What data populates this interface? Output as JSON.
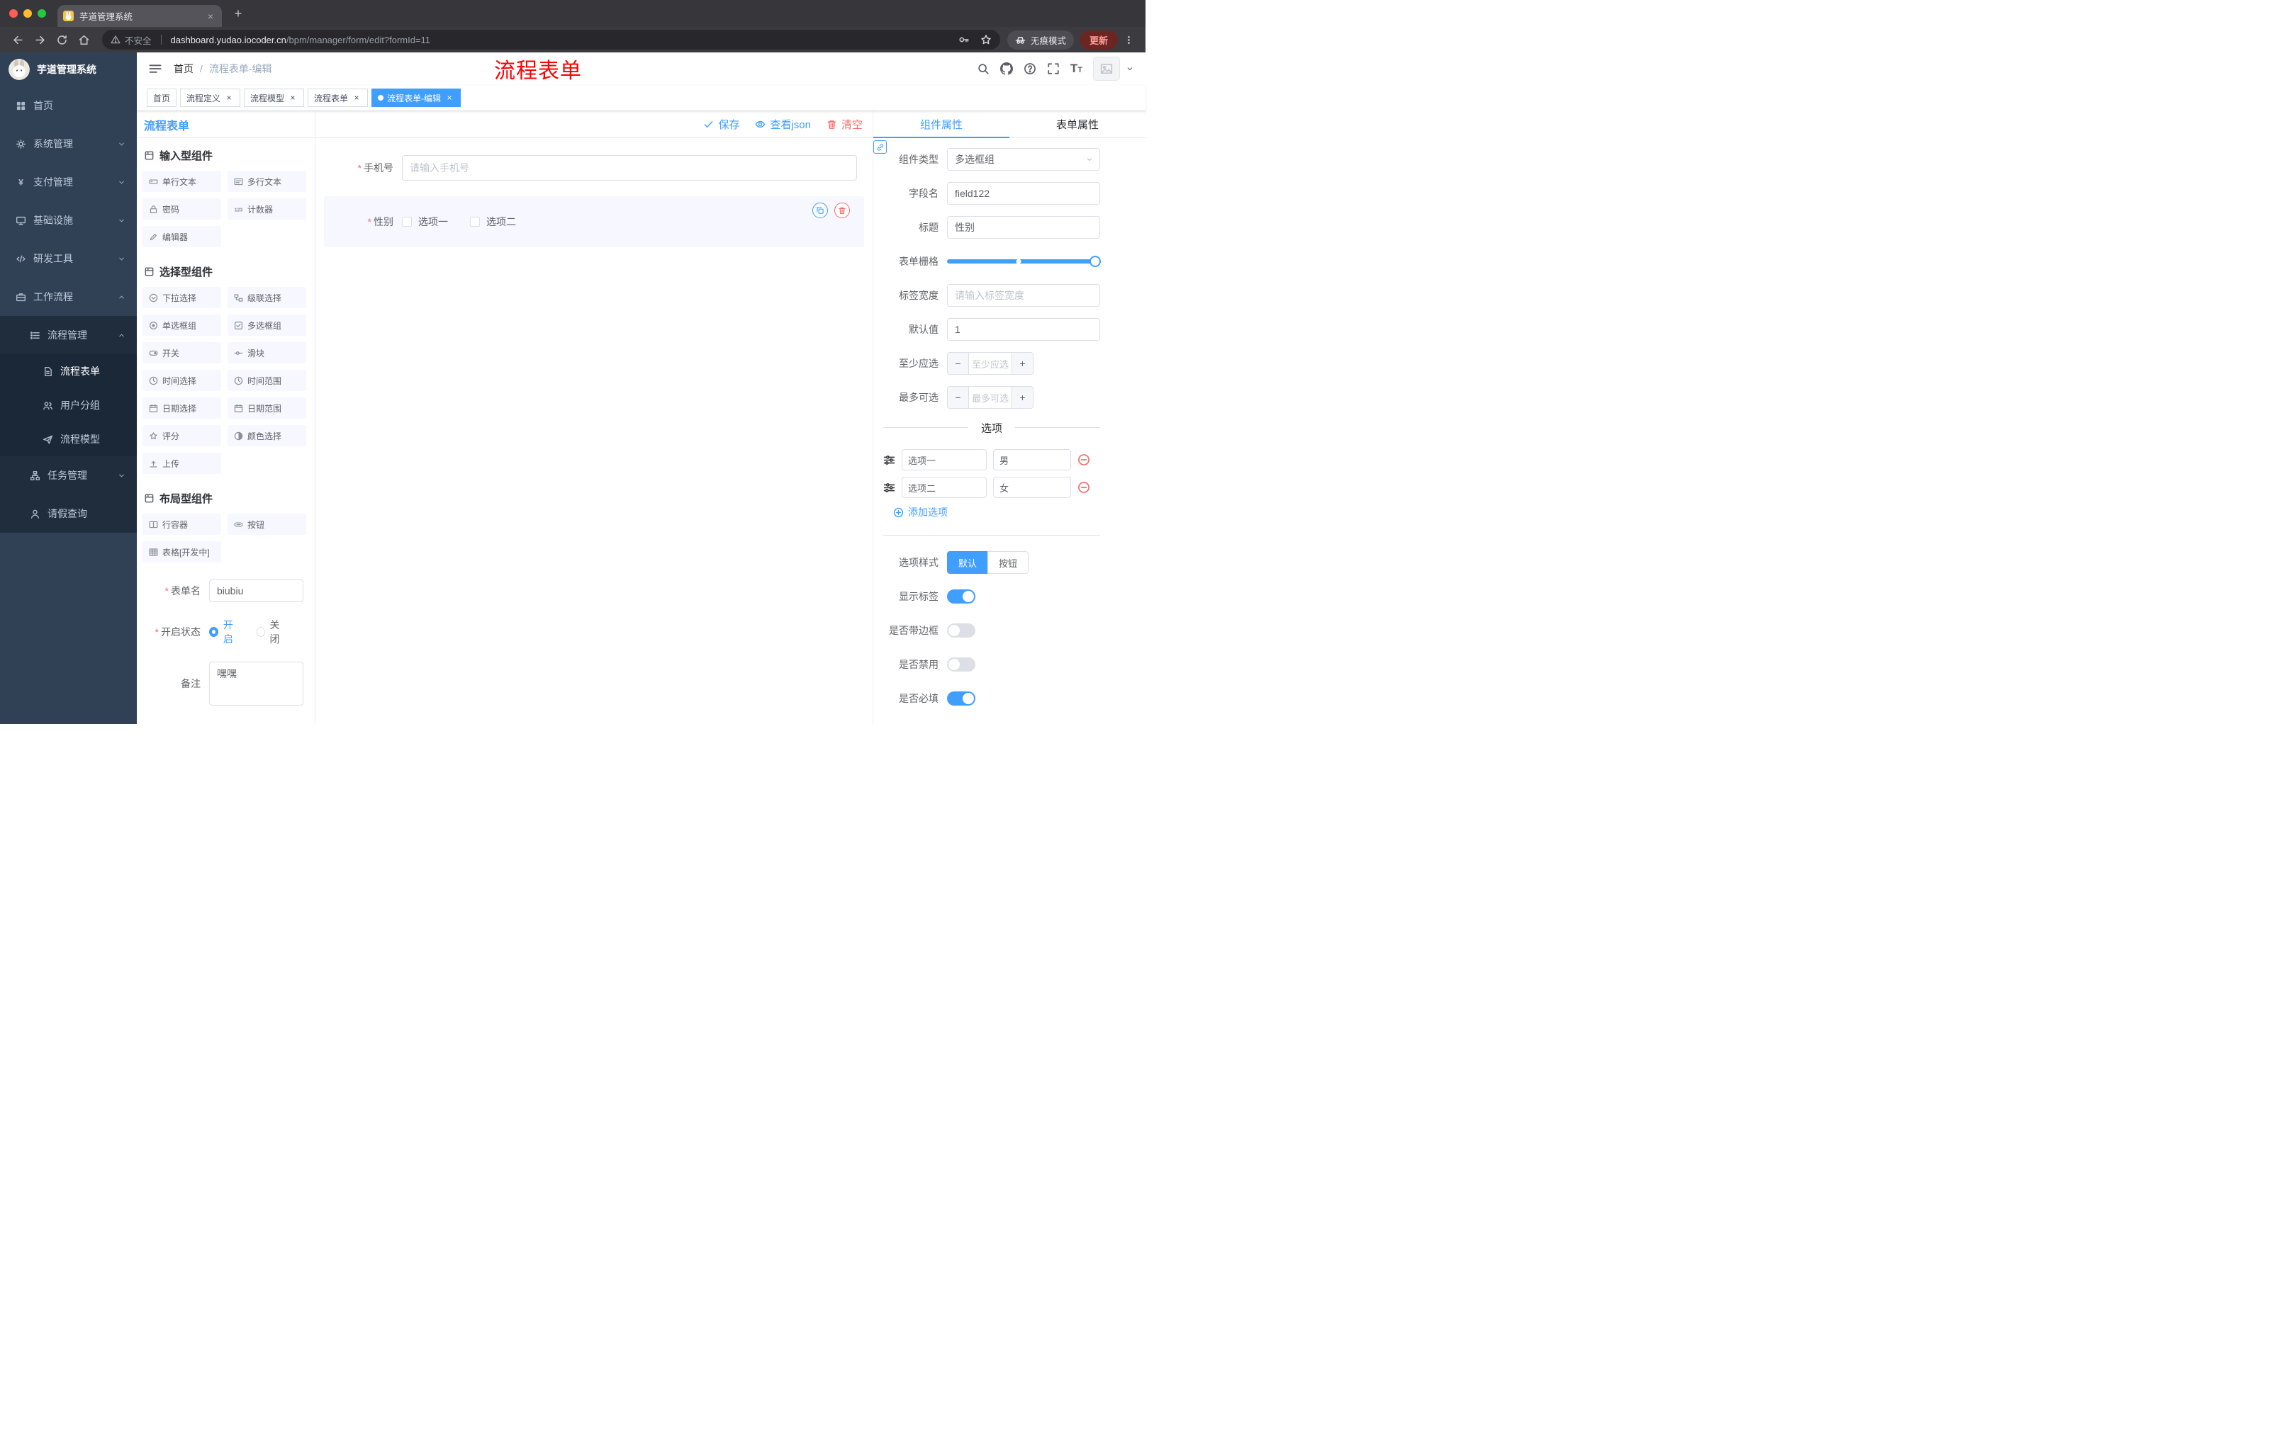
{
  "browser": {
    "tab_title": "芋道管理系统",
    "security_label": "不安全",
    "url_host": "dashboard.yudao.iocoder.cn",
    "url_path": "/bpm/manager/form/edit?formId=11",
    "incognito_label": "无痕模式",
    "update_label": "更新"
  },
  "sidebar": {
    "logo_title": "芋道管理系统",
    "menu": [
      {
        "label": "首页",
        "icon": "dashboard",
        "level": 1
      },
      {
        "label": "系统管理",
        "icon": "gear",
        "level": 1,
        "chevron": "down"
      },
      {
        "label": "支付管理",
        "icon": "yen",
        "level": 1,
        "chevron": "down"
      },
      {
        "label": "基础设施",
        "icon": "monitor",
        "level": 1,
        "chevron": "down"
      },
      {
        "label": "研发工具",
        "icon": "tools",
        "level": 1,
        "chevron": "down"
      },
      {
        "label": "工作流程",
        "icon": "briefcase",
        "level": 1,
        "chevron": "up"
      },
      {
        "label": "流程管理",
        "icon": "list",
        "level": 2,
        "chevron": "up"
      },
      {
        "label": "流程表单",
        "icon": "document",
        "level": 3,
        "active": true
      },
      {
        "label": "用户分组",
        "icon": "users",
        "level": 3
      },
      {
        "label": "流程模型",
        "icon": "send",
        "level": 3
      },
      {
        "label": "任务管理",
        "icon": "tree",
        "level": 2,
        "chevron": "down"
      },
      {
        "label": "请假查询",
        "icon": "user",
        "level": 2
      }
    ]
  },
  "navbar": {
    "breadcrumb": [
      "首页",
      "流程表单-编辑"
    ],
    "annotation": "流程表单"
  },
  "tags": [
    {
      "label": "首页",
      "closable": false,
      "active": false
    },
    {
      "label": "流程定义",
      "closable": true,
      "active": false
    },
    {
      "label": "流程模型",
      "closable": true,
      "active": false
    },
    {
      "label": "流程表单",
      "closable": true,
      "active": false
    },
    {
      "label": "流程表单-编辑",
      "closable": true,
      "active": true
    }
  ],
  "editor": {
    "title": "流程表单",
    "actions": {
      "save": "保存",
      "view_json": "查看json",
      "clear": "清空"
    },
    "component_groups": [
      {
        "title": "输入型组件",
        "items": [
          {
            "label": "单行文本",
            "icon": "input"
          },
          {
            "label": "多行文本",
            "icon": "textarea"
          },
          {
            "label": "密码",
            "icon": "password"
          },
          {
            "label": "计数器",
            "icon": "number"
          },
          {
            "label": "编辑器",
            "icon": "editor"
          }
        ]
      },
      {
        "title": "选择型组件",
        "items": [
          {
            "label": "下拉选择",
            "icon": "select"
          },
          {
            "label": "级联选择",
            "icon": "cascader"
          },
          {
            "label": "单选框组",
            "icon": "radio"
          },
          {
            "label": "多选框组",
            "icon": "checkbox"
          },
          {
            "label": "开关",
            "icon": "switch"
          },
          {
            "label": "滑块",
            "icon": "slider"
          },
          {
            "label": "时间选择",
            "icon": "time"
          },
          {
            "label": "时间范围",
            "icon": "time-range"
          },
          {
            "label": "日期选择",
            "icon": "date"
          },
          {
            "label": "日期范围",
            "icon": "date-range"
          },
          {
            "label": "评分",
            "icon": "rate"
          },
          {
            "label": "颜色选择",
            "icon": "color"
          },
          {
            "label": "上传",
            "icon": "upload"
          }
        ]
      },
      {
        "title": "布局型组件",
        "items": [
          {
            "label": "行容器",
            "icon": "row"
          },
          {
            "label": "按钮",
            "icon": "button"
          },
          {
            "label": "表格[开发中]",
            "icon": "table"
          }
        ]
      }
    ],
    "meta_form": {
      "form_name_label": "表单名",
      "form_name_value": "biubiu",
      "status_label": "开启状态",
      "status_on": "开启",
      "status_off": "关闭",
      "remark_label": "备注",
      "remark_value": "嘿嘿"
    }
  },
  "canvas": {
    "phone": {
      "label": "手机号",
      "placeholder": "请输入手机号",
      "required": true
    },
    "gender": {
      "label": "性别",
      "required": true,
      "options": [
        "选项一",
        "选项二"
      ]
    }
  },
  "props": {
    "tabs": [
      "组件属性",
      "表单属性"
    ],
    "rows": {
      "component_type": {
        "label": "组件类型",
        "value": "多选框组"
      },
      "field_name": {
        "label": "字段名",
        "value": "field122"
      },
      "title": {
        "label": "标题",
        "value": "性别"
      },
      "grid": {
        "label": "表单栅格"
      },
      "label_width": {
        "label": "标签宽度",
        "placeholder": "请输入标签宽度"
      },
      "default_value": {
        "label": "默认值",
        "value": "1"
      },
      "min_select": {
        "label": "至少应选",
        "placeholder": "至少应选"
      },
      "max_select": {
        "label": "最多可选",
        "placeholder": "最多可选"
      }
    },
    "options_divider": "选项",
    "options": [
      {
        "label": "选项一",
        "value": "男"
      },
      {
        "label": "选项二",
        "value": "女"
      }
    ],
    "add_option": "添加选项",
    "style_row": {
      "label": "选项样式",
      "options": [
        "默认",
        "按钮"
      ],
      "active": "默认"
    },
    "switches": [
      {
        "name": "show-label",
        "label": "显示标签",
        "on": true
      },
      {
        "name": "border",
        "label": "是否带边框",
        "on": false
      },
      {
        "name": "disabled",
        "label": "是否禁用",
        "on": false
      },
      {
        "name": "required",
        "label": "是否必填",
        "on": true
      }
    ]
  },
  "colors": {
    "accent": "#409eff",
    "danger": "#f56c6c",
    "annotation_red": "#fe0000",
    "sidebar_bg": "#304156",
    "submenu_bg": "#1f2d3d"
  }
}
